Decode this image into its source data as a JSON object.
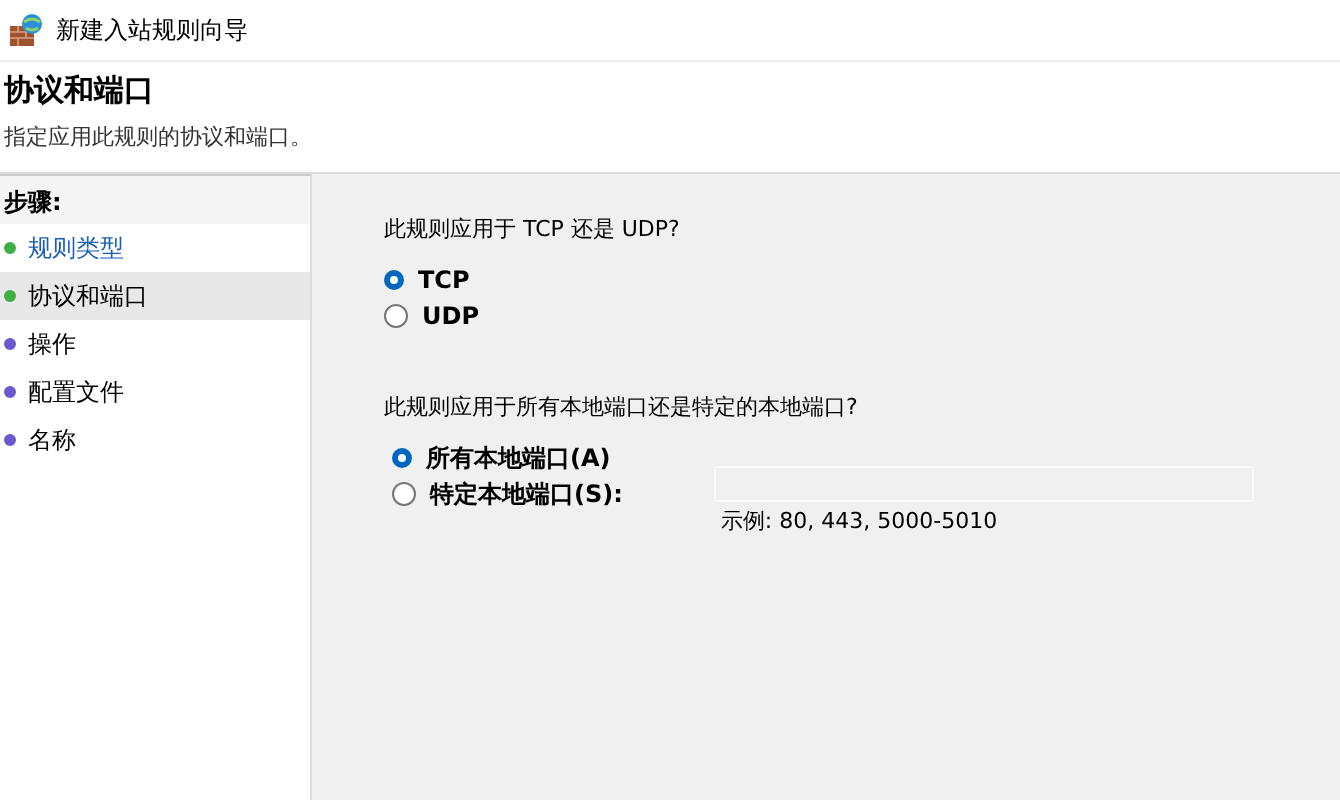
{
  "window": {
    "title": "新建入站规则向导"
  },
  "header": {
    "title": "协议和端口",
    "subtitle": "指定应用此规则的协议和端口。"
  },
  "steps": {
    "label": "步骤:",
    "items": [
      {
        "label": "规则类型",
        "color": "#3cb043",
        "completed": true,
        "selected": false
      },
      {
        "label": "协议和端口",
        "color": "#3cb043",
        "completed": false,
        "selected": true
      },
      {
        "label": "操作",
        "color": "#6a5acd",
        "completed": false,
        "selected": false
      },
      {
        "label": "配置文件",
        "color": "#6a5acd",
        "completed": false,
        "selected": false
      },
      {
        "label": "名称",
        "color": "#6a5acd",
        "completed": false,
        "selected": false
      }
    ]
  },
  "protocol": {
    "question": "此规则应用于 TCP 还是 UDP?",
    "options": [
      {
        "label": "TCP",
        "selected": true
      },
      {
        "label": "UDP",
        "selected": false
      }
    ]
  },
  "ports": {
    "question": "此规则应用于所有本地端口还是特定的本地端口?",
    "options": [
      {
        "label": "所有本地端口(A)",
        "selected": true
      },
      {
        "label": "特定本地端口(S):",
        "selected": false
      }
    ],
    "field": {
      "disabled": true
    },
    "example": "示例: 80, 443, 5000-5010"
  }
}
